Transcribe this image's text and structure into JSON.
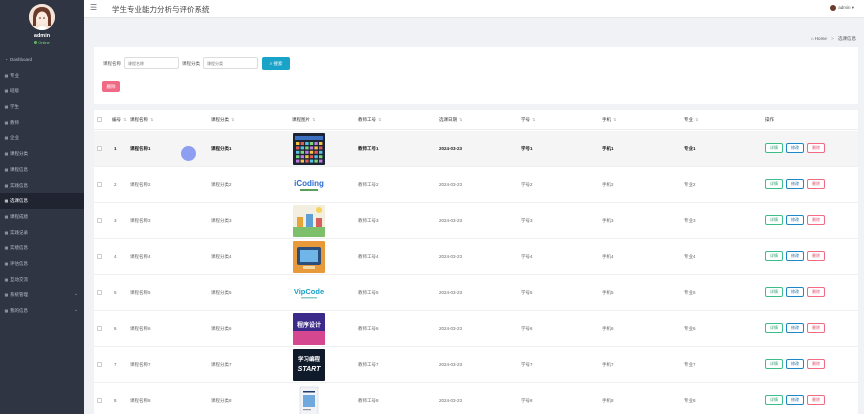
{
  "app": {
    "title": "学生专业能力分析与评价系统",
    "user": "admin",
    "status": "Online",
    "menu_icon": "hamburger-icon"
  },
  "breadcrumb": {
    "home": "Home",
    "separator": ">",
    "current": "选课信息"
  },
  "sidebar": {
    "items": [
      {
        "icon": "dashboard-icon",
        "label": "Dashboard",
        "active": false,
        "has_children": false
      },
      {
        "icon": "grid-icon",
        "label": "专业",
        "active": false,
        "has_children": false
      },
      {
        "icon": "grid-icon",
        "label": "班级",
        "active": false,
        "has_children": false
      },
      {
        "icon": "grid-icon",
        "label": "学生",
        "active": false,
        "has_children": false
      },
      {
        "icon": "grid-icon",
        "label": "教师",
        "active": false,
        "has_children": false
      },
      {
        "icon": "grid-icon",
        "label": "企业",
        "active": false,
        "has_children": false
      },
      {
        "icon": "grid-icon",
        "label": "课程分类",
        "active": false,
        "has_children": false
      },
      {
        "icon": "grid-icon",
        "label": "课程信息",
        "active": false,
        "has_children": false
      },
      {
        "icon": "grid-icon",
        "label": "实践信息",
        "active": false,
        "has_children": false
      },
      {
        "icon": "grid-icon",
        "label": "选课信息",
        "active": true,
        "has_children": false
      },
      {
        "icon": "grid-icon",
        "label": "课程成绩",
        "active": false,
        "has_children": false
      },
      {
        "icon": "grid-icon",
        "label": "实践记录",
        "active": false,
        "has_children": false
      },
      {
        "icon": "grid-icon",
        "label": "实绩信息",
        "active": false,
        "has_children": false
      },
      {
        "icon": "grid-icon",
        "label": "评估信息",
        "active": false,
        "has_children": false
      },
      {
        "icon": "grid-icon",
        "label": "互动交流",
        "active": false,
        "has_children": false
      },
      {
        "icon": "grid-icon",
        "label": "系统管理",
        "active": false,
        "has_children": true
      },
      {
        "icon": "grid-icon",
        "label": "我的信息",
        "active": false,
        "has_children": true
      }
    ]
  },
  "search": {
    "name_label": "课程名称",
    "name_placeholder": "课程名称",
    "category_label": "课程分类",
    "category_placeholder": "课程分类",
    "search_button": "搜索",
    "delete_button": "删除"
  },
  "table": {
    "columns": [
      "编号",
      "课程名称",
      "课程分类",
      "课程图片",
      "教师工号",
      "选课日期",
      "学号",
      "手机",
      "专业",
      "操作"
    ],
    "actions": {
      "detail": "详情",
      "edit": "修改",
      "delete": "删除"
    },
    "rows": [
      {
        "id": "1",
        "name": "课程名称1",
        "category": "课程分类1",
        "image": "course-thumb-1",
        "teacher": "教师工号1",
        "date": "2024-03-23",
        "student": "学号1",
        "phone": "手机1",
        "major": "专业1"
      },
      {
        "id": "2",
        "name": "课程名称2",
        "category": "课程分类2",
        "image": "course-thumb-2",
        "teacher": "教师工号2",
        "date": "2024-03-23",
        "student": "学号2",
        "phone": "手机2",
        "major": "专业2"
      },
      {
        "id": "3",
        "name": "课程名称3",
        "category": "课程分类3",
        "image": "course-thumb-3",
        "teacher": "教师工号3",
        "date": "2024-03-23",
        "student": "学号3",
        "phone": "手机3",
        "major": "专业3"
      },
      {
        "id": "4",
        "name": "课程名称4",
        "category": "课程分类4",
        "image": "course-thumb-4",
        "teacher": "教师工号4",
        "date": "2024-03-23",
        "student": "学号4",
        "phone": "手机4",
        "major": "专业4"
      },
      {
        "id": "5",
        "name": "课程名称5",
        "category": "课程分类5",
        "image": "course-thumb-5",
        "teacher": "教师工号5",
        "date": "2024-03-23",
        "student": "学号5",
        "phone": "手机5",
        "major": "专业5"
      },
      {
        "id": "6",
        "name": "课程名称6",
        "category": "课程分类6",
        "image": "course-thumb-6",
        "teacher": "教师工号6",
        "date": "2024-03-23",
        "student": "学号6",
        "phone": "手机6",
        "major": "专业6"
      },
      {
        "id": "7",
        "name": "课程名称7",
        "category": "课程分类7",
        "image": "course-thumb-7",
        "teacher": "教师工号7",
        "date": "2024-03-23",
        "student": "学号7",
        "phone": "手机7",
        "major": "专业7"
      },
      {
        "id": "8",
        "name": "课程名称8",
        "category": "课程分类8",
        "image": "course-thumb-8",
        "teacher": "教师工号8",
        "date": "2024-03-23",
        "student": "学号8",
        "phone": "手机8",
        "major": "专业8"
      }
    ]
  },
  "thumb_texts": {
    "t2": "iCoding",
    "t5": "VipCode",
    "t6": "程序设计",
    "t7a": "学习编程",
    "t7b": "START"
  },
  "colors": {
    "sidebar_bg": "#2f3542",
    "search_button": "#1aa3c8",
    "delete_button": "#f06a86",
    "detail_border": "#3bbf8a",
    "edit_border": "#1e88c7"
  }
}
